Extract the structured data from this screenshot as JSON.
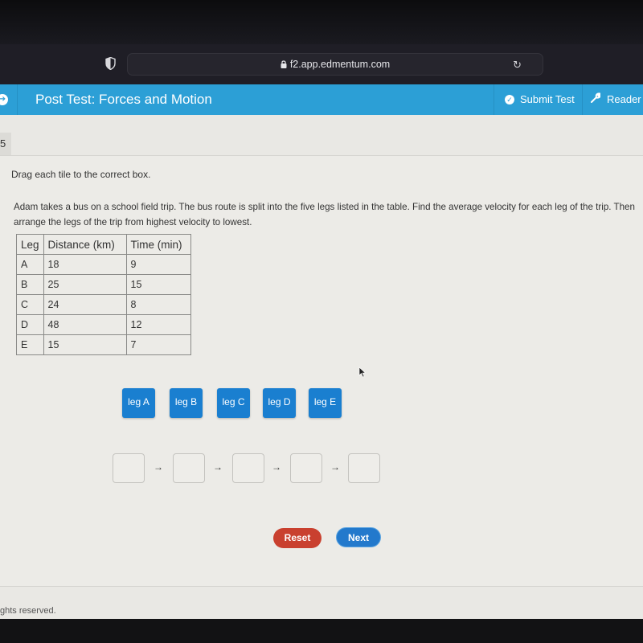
{
  "browser": {
    "url": "f2.app.edmentum.com",
    "shield_icon": "shield-icon",
    "lock_icon": "lock-icon",
    "reload_icon": "reload-icon"
  },
  "header": {
    "title": "Post Test: Forces and Motion",
    "nav_icon": "arrow-right-circle-icon",
    "submit_label": "Submit Test",
    "reader_label": "Reader T",
    "reload_glyph": "↻",
    "arrow_glyph": "➔",
    "check_glyph": "✓",
    "wrench_glyph": "🔧"
  },
  "question": {
    "number": "5",
    "instruction": "Drag each tile to the correct box.",
    "prompt": "Adam takes a bus on a school field trip. The bus route is split into the five legs listed in the table. Find the average velocity for each leg of the trip. Then arrange the legs of the trip from highest velocity to lowest."
  },
  "table": {
    "headers": [
      "Leg",
      "Distance (km)",
      "Time (min)"
    ],
    "rows": [
      [
        "A",
        "18",
        "9"
      ],
      [
        "B",
        "25",
        "15"
      ],
      [
        "C",
        "24",
        "8"
      ],
      [
        "D",
        "48",
        "12"
      ],
      [
        "E",
        "15",
        "7"
      ]
    ]
  },
  "tiles": [
    "leg A",
    "leg B",
    "leg C",
    "leg D",
    "leg E"
  ],
  "drop_boxes": [
    "",
    "",
    "",
    "",
    ""
  ],
  "arrow_glyph": "→",
  "buttons": {
    "reset": "Reset",
    "next": "Next"
  },
  "colors": {
    "header": "#2c9fd6",
    "tile": "#1a7fd0",
    "reset": "#c9402f",
    "next": "#2379cc"
  },
  "footer": {
    "text": "ghts reserved."
  }
}
